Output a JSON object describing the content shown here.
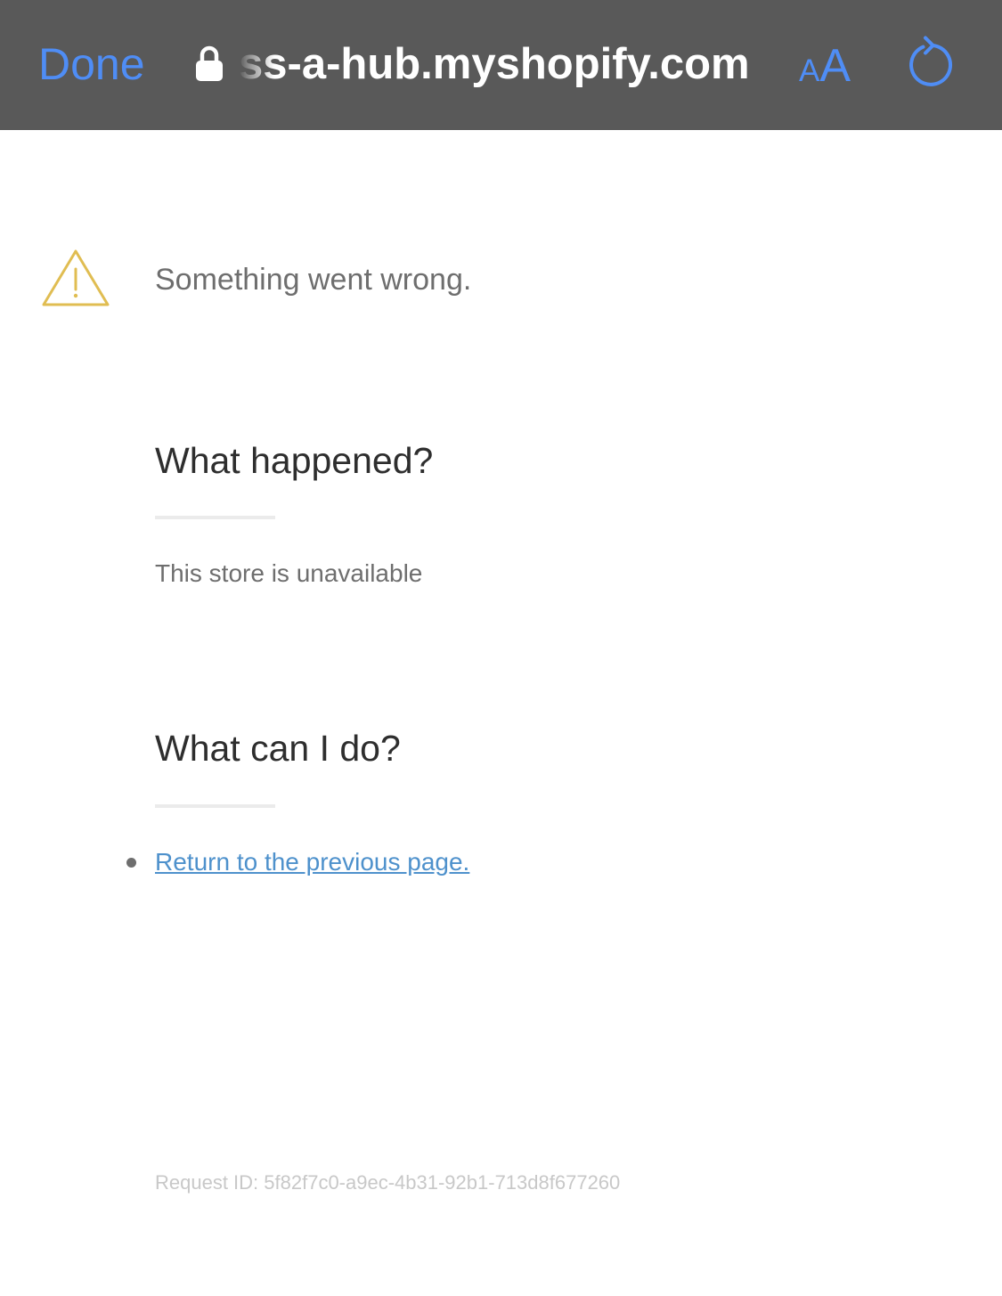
{
  "browser_bar": {
    "done_label": "Done",
    "url": "ss-a-hub.myshopify.com",
    "text_size_small": "A",
    "text_size_large": "A",
    "accent_color": "#4f8df5",
    "bar_color": "#595959",
    "icons": [
      "lock-icon",
      "text-size-icon",
      "reload-icon"
    ]
  },
  "error": {
    "icon": "warning-icon",
    "icon_color": "#e0bd52",
    "heading": "Something went wrong."
  },
  "what_happened": {
    "title": "What happened?",
    "text": "This store is unavailable"
  },
  "what_can_i_do": {
    "title": "What can I do?",
    "link": "Return to the previous page.",
    "link_color": "#4e91cc"
  },
  "footer": {
    "request_id": "Request ID: 5f82f7c0-a9ec-4b31-92b1-713d8f677260"
  }
}
